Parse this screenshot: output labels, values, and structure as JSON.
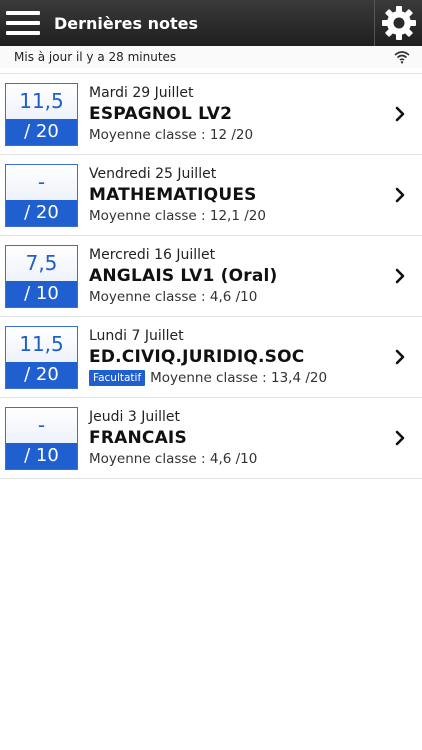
{
  "header": {
    "title": "Dernières notes",
    "menu_icon": "hamburger-menu-icon",
    "settings_icon": "gear-icon"
  },
  "status": {
    "updated_text": "Mis à jour il y a 28 minutes",
    "icon": "wifi-icon"
  },
  "colors": {
    "accent": "#1f5fd0",
    "topbar": "#2a2a2a"
  },
  "grades": [
    {
      "grade": "11,5",
      "scale": "/ 20",
      "date": "Mardi 29 Juillet",
      "subject": "ESPAGNOL LV2",
      "average": "Moyenne classe : 12 /20",
      "badge": ""
    },
    {
      "grade": "-",
      "scale": "/ 20",
      "date": "Vendredi 25 Juillet",
      "subject": "MATHEMATIQUES",
      "average": "Moyenne classe : 12,1 /20",
      "badge": ""
    },
    {
      "grade": "7,5",
      "scale": "/ 10",
      "date": "Mercredi 16 Juillet",
      "subject": "ANGLAIS LV1 (Oral)",
      "average": "Moyenne classe : 4,6 /10",
      "badge": ""
    },
    {
      "grade": "11,5",
      "scale": "/ 20",
      "date": "Lundi 7 Juillet",
      "subject": "ED.CIVIQ.JURIDIQ.SOC",
      "average": "Moyenne classe : 13,4 /20",
      "badge": "Facultatif"
    },
    {
      "grade": "-",
      "scale": "/ 10",
      "date": "Jeudi 3 Juillet",
      "subject": "FRANCAIS",
      "average": "Moyenne classe : 4,6 /10",
      "badge": ""
    }
  ]
}
